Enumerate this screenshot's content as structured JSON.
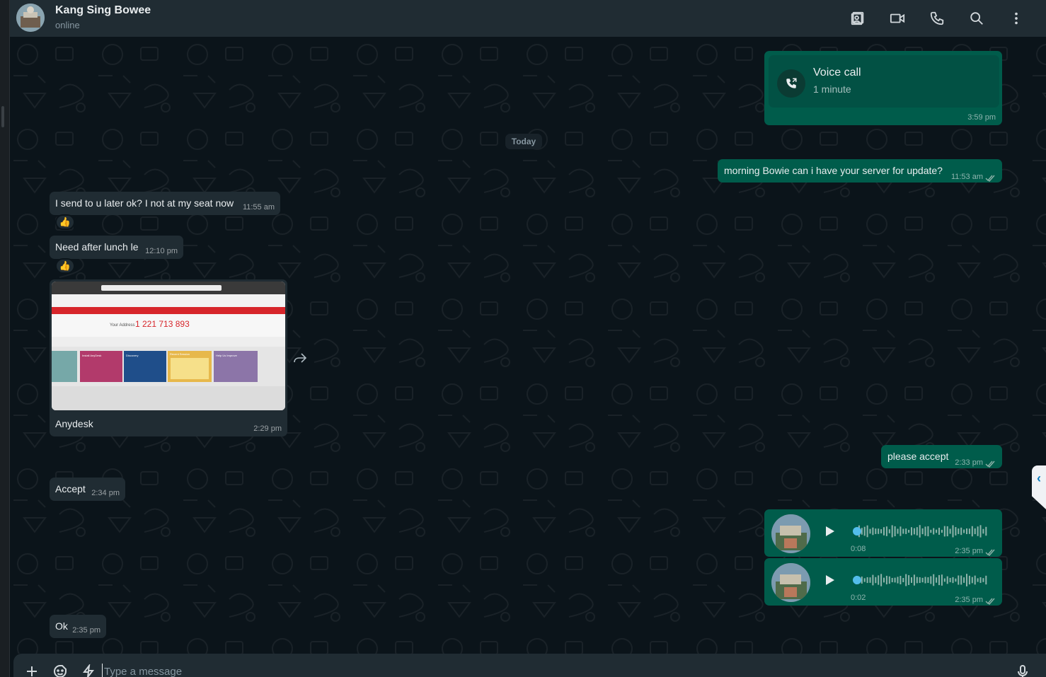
{
  "header": {
    "contact_name": "Kang Sing Bowee",
    "status": "online",
    "icons": [
      "contact-card-icon",
      "video-call-icon",
      "voice-call-icon",
      "search-icon",
      "more-options-icon"
    ]
  },
  "date_divider": "Today",
  "messages": {
    "voice_call": {
      "title": "Voice call",
      "subtitle": "1 minute",
      "time": "3:59 pm"
    },
    "m1": {
      "text": "morning Bowie can i have your server for update?",
      "time": "11:53 am"
    },
    "m2": {
      "text": "I send to u later ok? I not at my seat now",
      "time": "11:55 am",
      "reaction": "👍"
    },
    "m3": {
      "text": "Need after lunch le",
      "time": "12:10 pm",
      "reaction": "👍"
    },
    "m4": {
      "caption": "Anydesk",
      "time": "2:29 pm",
      "screen": {
        "your_address_label": "Your Address",
        "address": "1 221 713 893",
        "cards": [
          "Install AnyDesk",
          "Discovery",
          "Recent Session",
          "Help Us Improve"
        ]
      }
    },
    "m5": {
      "text": "please accept",
      "time": "2:33 pm"
    },
    "m6": {
      "text": "Accept",
      "time": "2:34 pm"
    },
    "v1": {
      "duration": "0:08",
      "time": "2:35 pm"
    },
    "v2": {
      "duration": "0:02",
      "time": "2:35 pm"
    },
    "m7": {
      "text": "Ok",
      "time": "2:35 pm"
    }
  },
  "composer": {
    "placeholder": "Type a message"
  },
  "colors": {
    "incoming": "#202c33",
    "outgoing": "#005c4b",
    "background": "#0b141a",
    "accent": "#53bdeb"
  }
}
